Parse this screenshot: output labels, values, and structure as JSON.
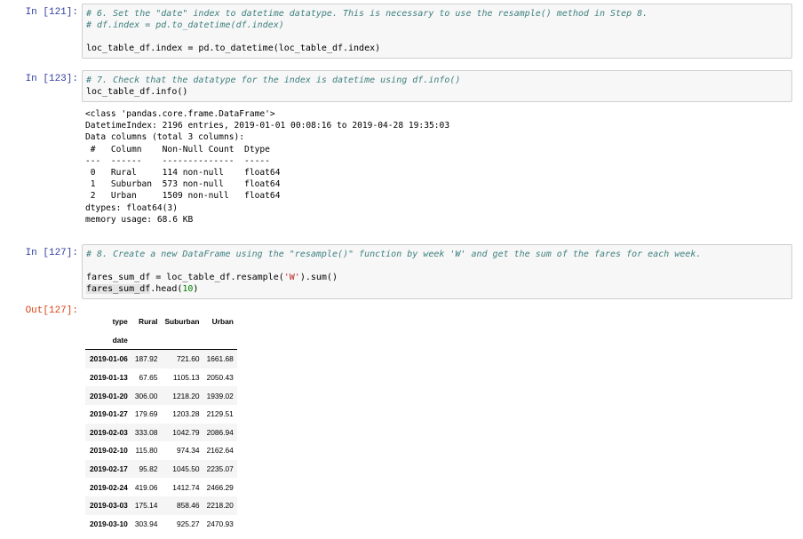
{
  "cells": [
    {
      "prompt": "In [121]:",
      "lines": [
        {
          "comment": "# 6. Set the \"date\" index to datetime datatype. This is necessary to use the resample() method in Step 8."
        },
        {
          "comment": "# df.index = pd.to_datetime(df.index)"
        },
        {
          "blank": ""
        },
        {
          "code": "loc_table_df.index = pd.to_datetime(loc_table_df.index)"
        }
      ]
    },
    {
      "prompt": "In [123]:",
      "lines": [
        {
          "comment": "# 7. Check that the datatype for the index is datetime using df.info()"
        },
        {
          "code": "loc_table_df.info()"
        }
      ],
      "output": "<class 'pandas.core.frame.DataFrame'>\nDatetimeIndex: 2196 entries, 2019-01-01 00:08:16 to 2019-04-28 19:35:03\nData columns (total 3 columns):\n #   Column    Non-Null Count  Dtype  \n---  ------    --------------  -----  \n 0   Rural     114 non-null    float64\n 1   Suburban  573 non-null    float64\n 2   Urban     1509 non-null   float64\ndtypes: float64(3)\nmemory usage: 68.6 KB"
    },
    {
      "prompt": "In [127]:",
      "out_prompt": "Out[127]:",
      "lines": [
        {
          "comment": "# 8. Create a new DataFrame using the \"resample()\" function by week 'W' and get the sum of the fares for each week."
        },
        {
          "blank": ""
        },
        {
          "code_a": "fares_sum_df = loc_table_df.resample(",
          "str": "'W'",
          "code_b": ").sum()"
        },
        {
          "code_hl": "fares_sum_df",
          "code_a": ".head(",
          "num": "10",
          "code_b": ")"
        }
      ]
    }
  ],
  "dataframe": {
    "columns_label": "type",
    "columns": [
      "Rural",
      "Suburban",
      "Urban"
    ],
    "index_name": "date",
    "rows": [
      {
        "date": "2019-01-06",
        "values": [
          "187.92",
          "721.60",
          "1661.68"
        ]
      },
      {
        "date": "2019-01-13",
        "values": [
          "67.65",
          "1105.13",
          "2050.43"
        ]
      },
      {
        "date": "2019-01-20",
        "values": [
          "306.00",
          "1218.20",
          "1939.02"
        ]
      },
      {
        "date": "2019-01-27",
        "values": [
          "179.69",
          "1203.28",
          "2129.51"
        ]
      },
      {
        "date": "2019-02-03",
        "values": [
          "333.08",
          "1042.79",
          "2086.94"
        ]
      },
      {
        "date": "2019-02-10",
        "values": [
          "115.80",
          "974.34",
          "2162.64"
        ]
      },
      {
        "date": "2019-02-17",
        "values": [
          "95.82",
          "1045.50",
          "2235.07"
        ]
      },
      {
        "date": "2019-02-24",
        "values": [
          "419.06",
          "1412.74",
          "2466.29"
        ]
      },
      {
        "date": "2019-03-03",
        "values": [
          "175.14",
          "858.46",
          "2218.20"
        ]
      },
      {
        "date": "2019-03-10",
        "values": [
          "303.94",
          "925.27",
          "2470.93"
        ]
      }
    ]
  }
}
